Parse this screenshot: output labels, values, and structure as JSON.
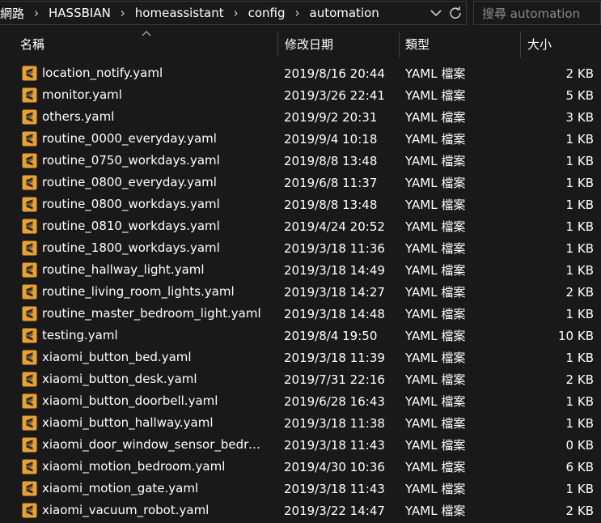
{
  "breadcrumb": [
    "網路",
    "HASSBIAN",
    "homeassistant",
    "config",
    "automation"
  ],
  "search": {
    "placeholder": "搜尋 automation"
  },
  "columns": {
    "name": "名稱",
    "date": "修改日期",
    "type": "類型",
    "size": "大小"
  },
  "colors": {
    "background": "#191919",
    "text": "#ffffff",
    "icon_bg": "#e8a030"
  },
  "icons": {
    "file": "sublime-text-file-icon",
    "dropdown": "chevron-down-icon",
    "refresh": "refresh-icon",
    "separator": "chevron-right-icon"
  },
  "files": [
    {
      "name": "location_notify.yaml",
      "date": "2019/8/16 20:44",
      "type": "YAML 檔案",
      "size": "2 KB"
    },
    {
      "name": "monitor.yaml",
      "date": "2019/3/26 22:41",
      "type": "YAML 檔案",
      "size": "5 KB"
    },
    {
      "name": "others.yaml",
      "date": "2019/9/2 20:31",
      "type": "YAML 檔案",
      "size": "3 KB"
    },
    {
      "name": "routine_0000_everyday.yaml",
      "date": "2019/9/4 10:18",
      "type": "YAML 檔案",
      "size": "1 KB"
    },
    {
      "name": "routine_0750_workdays.yaml",
      "date": "2019/8/8 13:48",
      "type": "YAML 檔案",
      "size": "1 KB"
    },
    {
      "name": "routine_0800_everyday.yaml",
      "date": "2019/6/8 11:37",
      "type": "YAML 檔案",
      "size": "1 KB"
    },
    {
      "name": "routine_0800_workdays.yaml",
      "date": "2019/8/8 13:48",
      "type": "YAML 檔案",
      "size": "1 KB"
    },
    {
      "name": "routine_0810_workdays.yaml",
      "date": "2019/4/24 20:52",
      "type": "YAML 檔案",
      "size": "1 KB"
    },
    {
      "name": "routine_1800_workdays.yaml",
      "date": "2019/3/18 11:36",
      "type": "YAML 檔案",
      "size": "1 KB"
    },
    {
      "name": "routine_hallway_light.yaml",
      "date": "2019/3/18 14:49",
      "type": "YAML 檔案",
      "size": "1 KB"
    },
    {
      "name": "routine_living_room_lights.yaml",
      "date": "2019/3/18 14:27",
      "type": "YAML 檔案",
      "size": "2 KB"
    },
    {
      "name": "routine_master_bedroom_light.yaml",
      "date": "2019/3/18 14:48",
      "type": "YAML 檔案",
      "size": "1 KB"
    },
    {
      "name": "testing.yaml",
      "date": "2019/8/4 19:50",
      "type": "YAML 檔案",
      "size": "10 KB"
    },
    {
      "name": "xiaomi_button_bed.yaml",
      "date": "2019/3/18 11:39",
      "type": "YAML 檔案",
      "size": "1 KB"
    },
    {
      "name": "xiaomi_button_desk.yaml",
      "date": "2019/7/31 22:16",
      "type": "YAML 檔案",
      "size": "2 KB"
    },
    {
      "name": "xiaomi_button_doorbell.yaml",
      "date": "2019/6/28 16:43",
      "type": "YAML 檔案",
      "size": "1 KB"
    },
    {
      "name": "xiaomi_button_hallway.yaml",
      "date": "2019/3/18 11:38",
      "type": "YAML 檔案",
      "size": "1 KB"
    },
    {
      "name": "xiaomi_door_window_sensor_bedroo...",
      "date": "2019/3/18 11:43",
      "type": "YAML 檔案",
      "size": "0 KB"
    },
    {
      "name": "xiaomi_motion_bedroom.yaml",
      "date": "2019/4/30 10:36",
      "type": "YAML 檔案",
      "size": "6 KB"
    },
    {
      "name": "xiaomi_motion_gate.yaml",
      "date": "2019/3/18 11:43",
      "type": "YAML 檔案",
      "size": "1 KB"
    },
    {
      "name": "xiaomi_vacuum_robot.yaml",
      "date": "2019/3/22 14:47",
      "type": "YAML 檔案",
      "size": "2 KB"
    }
  ]
}
